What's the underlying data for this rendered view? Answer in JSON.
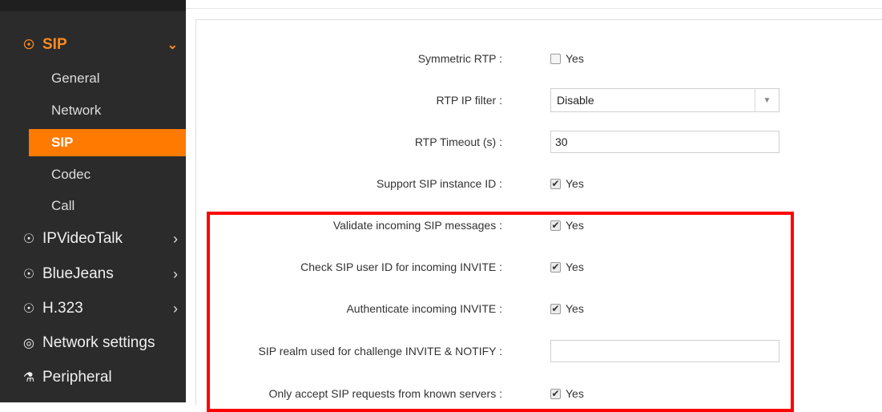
{
  "colors": {
    "accent": "#ff7a00",
    "sidebar_bg": "#2b2b2b",
    "highlight": "#ff0000"
  },
  "sidebar": {
    "sip_section": {
      "label": "SIP",
      "icon": "circle-icon"
    },
    "sip_subitems": [
      {
        "label": "General"
      },
      {
        "label": "Network"
      },
      {
        "label": "SIP",
        "selected": true
      },
      {
        "label": "Codec"
      },
      {
        "label": "Call"
      }
    ],
    "sections": [
      {
        "label": "IPVideoTalk",
        "icon": "circle-icon"
      },
      {
        "label": "BlueJeans",
        "icon": "circle-icon"
      },
      {
        "label": "H.323",
        "icon": "circle-icon"
      },
      {
        "label": "Network settings",
        "icon": "globe-icon"
      },
      {
        "label": "Peripheral",
        "icon": "peripheral-icon"
      }
    ]
  },
  "settings": {
    "symmetric_rtp": {
      "label": "Symmetric RTP :",
      "checked": false,
      "option": "Yes"
    },
    "rtp_ip_filter": {
      "label": "RTP IP filter :",
      "value": "Disable"
    },
    "rtp_timeout": {
      "label": "RTP Timeout (s) :",
      "value": "30"
    },
    "sip_instance_id": {
      "label": "Support SIP instance ID :",
      "checked": true,
      "option": "Yes"
    },
    "validate_incoming": {
      "label": "Validate incoming SIP messages :",
      "checked": true,
      "option": "Yes"
    },
    "check_user_id": {
      "label": "Check SIP user ID for incoming INVITE :",
      "checked": true,
      "option": "Yes"
    },
    "authenticate_invite": {
      "label": "Authenticate incoming INVITE :",
      "checked": true,
      "option": "Yes"
    },
    "sip_realm": {
      "label": "SIP realm used for challenge INVITE & NOTIFY :",
      "value": ""
    },
    "known_servers": {
      "label": "Only accept SIP requests from known servers :",
      "checked": true,
      "option": "Yes"
    }
  }
}
